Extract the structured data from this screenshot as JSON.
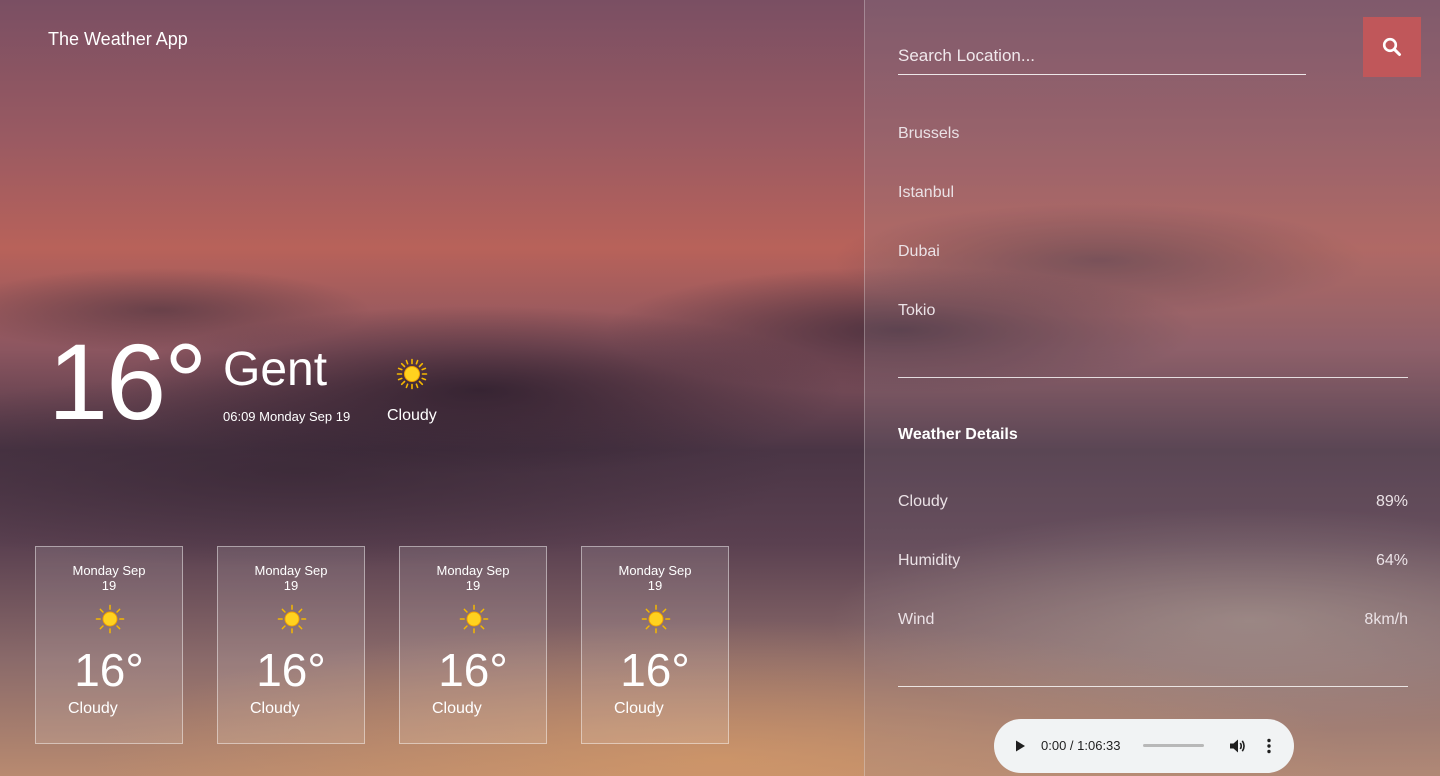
{
  "app": {
    "title": "The Weather App"
  },
  "current": {
    "temperature": "16°",
    "city": "Gent",
    "datetime": "06:09 Monday Sep 19",
    "icon": "sun-icon",
    "condition": "Cloudy"
  },
  "forecast": [
    {
      "date": "Monday Sep 19",
      "icon": "sun-icon",
      "temperature": "16°",
      "condition": "Cloudy"
    },
    {
      "date": "Monday Sep 19",
      "icon": "sun-icon",
      "temperature": "16°",
      "condition": "Cloudy"
    },
    {
      "date": "Monday Sep 19",
      "icon": "sun-icon",
      "temperature": "16°",
      "condition": "Cloudy"
    },
    {
      "date": "Monday Sep 19",
      "icon": "sun-icon",
      "temperature": "16°",
      "condition": "Cloudy"
    }
  ],
  "search": {
    "placeholder": "Search Location...",
    "value": "",
    "button_icon": "search-icon"
  },
  "cities": [
    {
      "label": "Brussels"
    },
    {
      "label": "Istanbul"
    },
    {
      "label": "Dubai"
    },
    {
      "label": "Tokio"
    }
  ],
  "details": {
    "title": "Weather Details",
    "rows": [
      {
        "label": "Cloudy",
        "value": "89%"
      },
      {
        "label": "Humidity",
        "value": "64%"
      },
      {
        "label": "Wind",
        "value": "8km/h"
      }
    ]
  },
  "audio": {
    "time": "0:00 / 1:06:33",
    "progress": 0
  },
  "colors": {
    "accent": "#c0575a",
    "sun": "#f5b800",
    "text": "#ffffff"
  }
}
